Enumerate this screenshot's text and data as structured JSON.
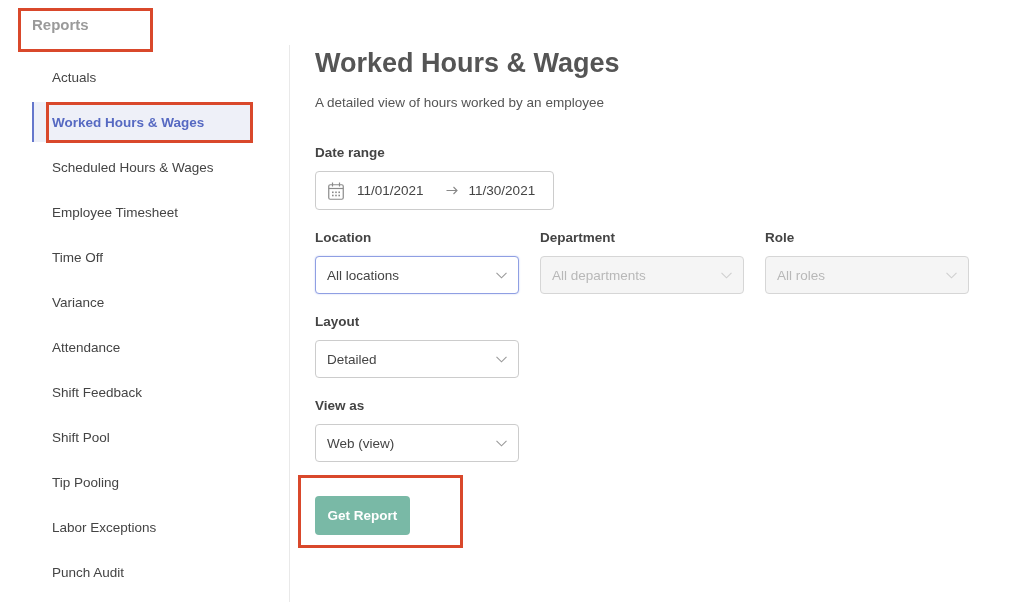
{
  "sidebar": {
    "header": {
      "label": "Reports",
      "highlighted": true
    },
    "items": [
      {
        "label": "Actuals",
        "selected": false,
        "highlighted": false
      },
      {
        "label": "Worked Hours & Wages",
        "selected": true,
        "highlighted": true
      },
      {
        "label": "Scheduled Hours & Wages",
        "selected": false,
        "highlighted": false
      },
      {
        "label": "Employee Timesheet",
        "selected": false,
        "highlighted": false
      },
      {
        "label": "Time Off",
        "selected": false,
        "highlighted": false
      },
      {
        "label": "Variance",
        "selected": false,
        "highlighted": false
      },
      {
        "label": "Attendance",
        "selected": false,
        "highlighted": false
      },
      {
        "label": "Shift Feedback",
        "selected": false,
        "highlighted": false
      },
      {
        "label": "Shift Pool",
        "selected": false,
        "highlighted": false
      },
      {
        "label": "Tip Pooling",
        "selected": false,
        "highlighted": false
      },
      {
        "label": "Labor Exceptions",
        "selected": false,
        "highlighted": false
      },
      {
        "label": "Punch Audit",
        "selected": false,
        "highlighted": false
      }
    ]
  },
  "main": {
    "title": "Worked Hours & Wages",
    "subtitle": "A detailed view of hours worked by an employee",
    "date_range": {
      "label": "Date range",
      "start": "11/01/2021",
      "end": "11/30/2021"
    },
    "field_rows": [
      {
        "fields": [
          {
            "label": "Location",
            "value": "All locations",
            "focused": true,
            "disabled": false
          },
          {
            "label": "Department",
            "value": "All departments",
            "focused": false,
            "disabled": true
          },
          {
            "label": "Role",
            "value": "All roles",
            "focused": false,
            "disabled": true
          }
        ]
      },
      {
        "fields": [
          {
            "label": "Layout",
            "value": "Detailed",
            "focused": false,
            "disabled": false
          }
        ]
      },
      {
        "fields": [
          {
            "label": "View as",
            "value": "Web (view)",
            "focused": false,
            "disabled": false
          }
        ]
      }
    ],
    "get_report_button": {
      "label": "Get Report",
      "highlighted": true
    }
  }
}
